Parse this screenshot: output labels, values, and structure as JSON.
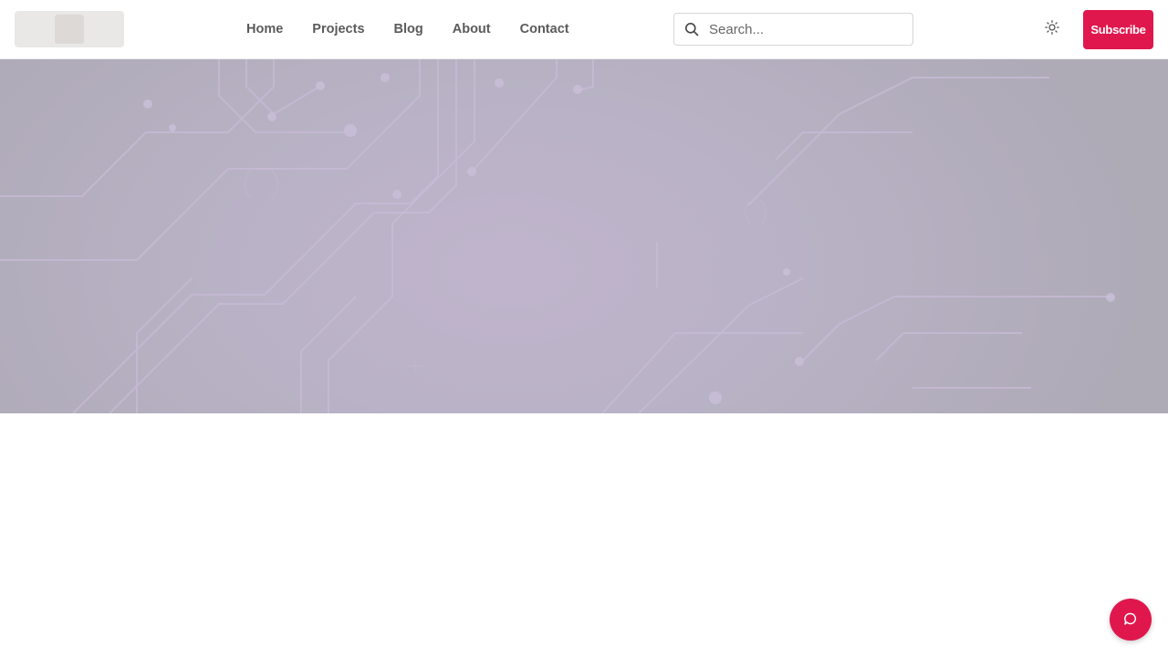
{
  "nav": {
    "items": [
      {
        "label": "Home"
      },
      {
        "label": "Projects"
      },
      {
        "label": "Blog"
      },
      {
        "label": "About"
      },
      {
        "label": "Contact"
      }
    ]
  },
  "search": {
    "placeholder": "Search...",
    "value": "",
    "icon": "search-icon"
  },
  "header": {
    "theme_toggle_icon": "sun-icon",
    "subscribe_label": "Subscribe"
  },
  "hero": {
    "background": "circuit-board-pattern",
    "tint": "#bdb3c8"
  },
  "chat": {
    "icon": "chat-bubble-icon"
  },
  "colors": {
    "accent": "#e0174d",
    "nav_text": "#5b5b5b"
  }
}
